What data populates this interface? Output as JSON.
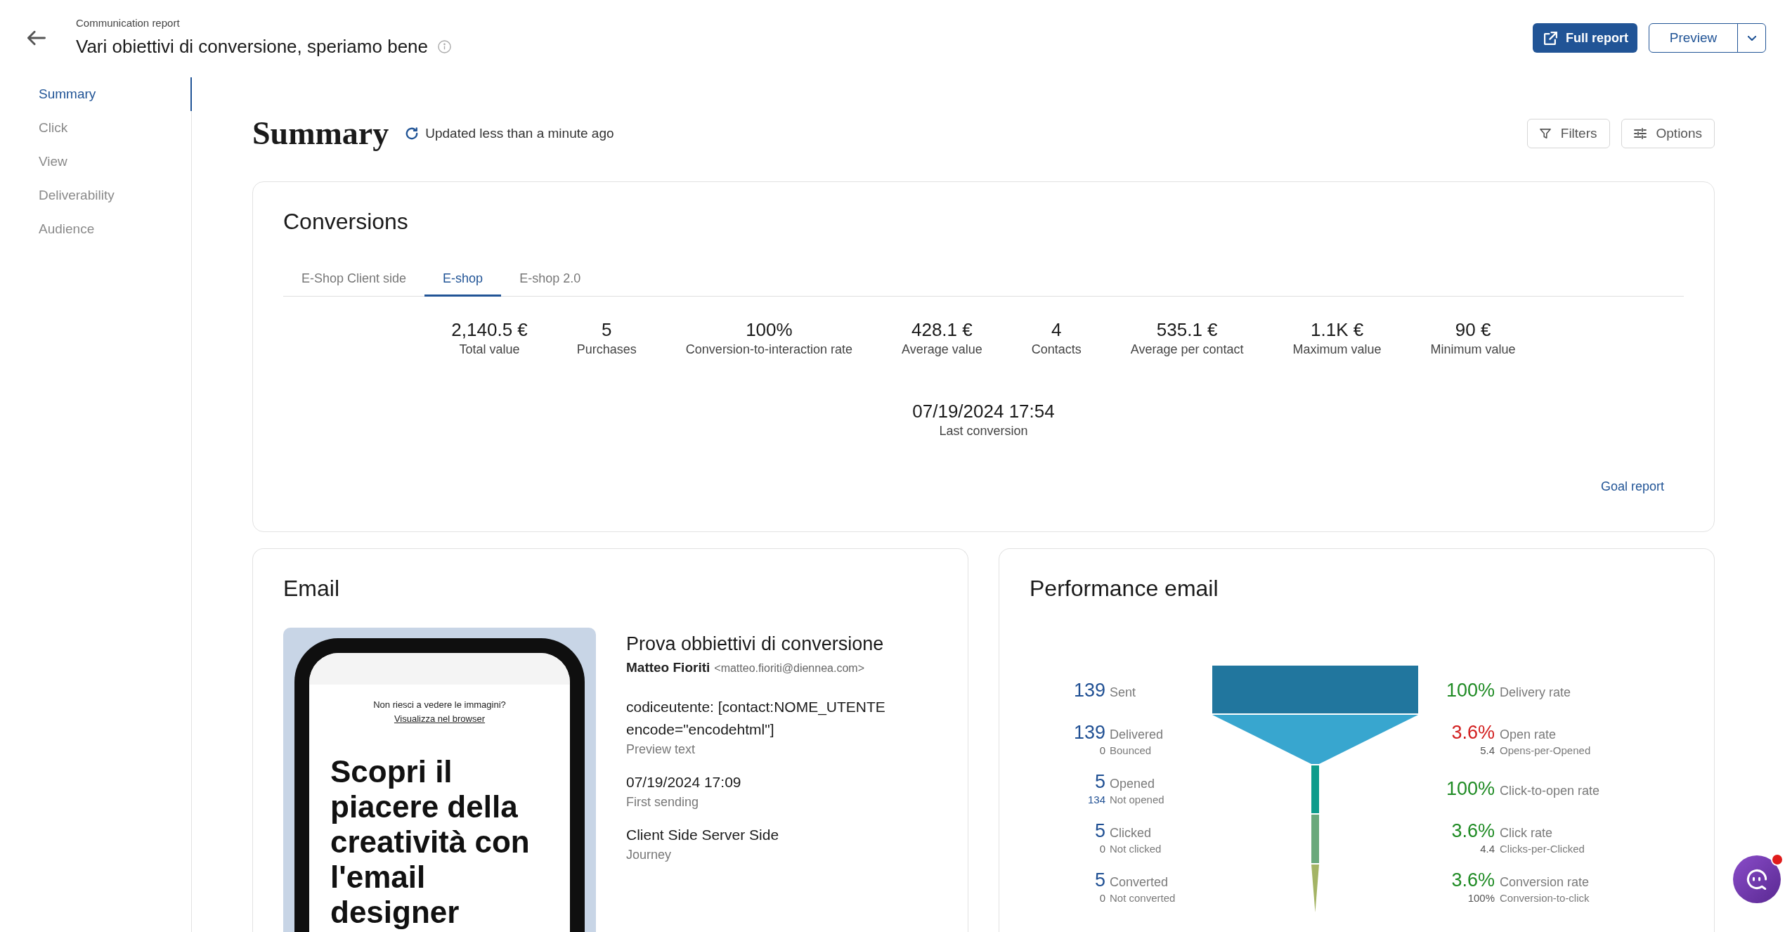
{
  "header": {
    "breadcrumb": "Communication report",
    "title": "Vari obiettivi di conversione, speriamo bene"
  },
  "actions": [
    {
      "kind": "primary",
      "label": "Full report"
    },
    {
      "kind": "split",
      "label": "Preview"
    }
  ],
  "sidebar": {
    "items": [
      {
        "label": "Summary",
        "selected": true
      },
      {
        "label": "Click",
        "selected": false
      },
      {
        "label": "View",
        "selected": false
      },
      {
        "label": "Deliverability",
        "selected": false
      },
      {
        "label": "Audience",
        "selected": false
      }
    ]
  },
  "summary": {
    "title": "Summary",
    "updated": "Updated less than a minute ago",
    "tools": [
      {
        "kind": "filter",
        "label": "Filters"
      },
      {
        "kind": "options",
        "label": "Options"
      }
    ]
  },
  "conversions": {
    "title": "Conversions",
    "tabs": [
      {
        "label": "E-Shop Client side",
        "selected": false
      },
      {
        "label": "E-shop",
        "selected": true
      },
      {
        "label": "E-shop 2.0",
        "selected": false
      }
    ],
    "stats": [
      {
        "value": "2,140.5 €",
        "label": "Total value"
      },
      {
        "value": "5",
        "label": "Purchases"
      },
      {
        "value": "100%",
        "label": "Conversion-to-interaction rate"
      },
      {
        "value": "428.1 €",
        "label": "Average value"
      },
      {
        "value": "4",
        "label": "Contacts"
      },
      {
        "value": "535.1 €",
        "label": "Average per contact"
      },
      {
        "value": "1.1K €",
        "label": "Maximum value"
      },
      {
        "value": "90 €",
        "label": "Minimum value"
      }
    ],
    "last_conversion": {
      "value": "07/19/2024 17:54",
      "label": "Last conversion"
    },
    "link": "Goal report"
  },
  "email": {
    "title": "Email",
    "preview": {
      "notice": "Non riesci a vedere le immagini?",
      "notice_link": "Visualizza nel browser",
      "headline": "Scopri il piacere della creatività con l'email designer"
    },
    "subject": "Prova obbiettivi di conversione",
    "sender_name": "Matteo Fioriti",
    "sender_email": "<matteo.fioriti@diennea.com>",
    "fields": [
      {
        "value": "codiceutente: [contact:NOME_UTENTE encode=\"encodehtml\"]",
        "label": "Preview text"
      },
      {
        "value": "07/19/2024 17:09",
        "label": "First sending"
      },
      {
        "value": "Client Side Server Side",
        "label": "Journey"
      }
    ]
  },
  "performance": {
    "title": "Performance email",
    "counts": [
      {
        "value": "139",
        "label": "Sent"
      },
      {
        "value": "139",
        "label": "Delivered",
        "sub_value": "0",
        "sub_label": "Bounced",
        "sub_highlight": false
      },
      {
        "value": "5",
        "label": "Opened",
        "sub_value": "134",
        "sub_label": "Not opened",
        "sub_highlight": true
      },
      {
        "value": "5",
        "label": "Clicked",
        "sub_value": "0",
        "sub_label": "Not clicked",
        "sub_highlight": false
      },
      {
        "value": "5",
        "label": "Converted",
        "sub_value": "0",
        "sub_label": "Not converted",
        "sub_highlight": false
      }
    ],
    "rates": [
      {
        "value": "100%",
        "label": "Delivery rate",
        "color": "#1f8b24"
      },
      {
        "value": "3.6%",
        "label": "Open rate",
        "color": "#d21f1f",
        "sub_value": "5.4",
        "sub_label": "Opens-per-Opened"
      },
      {
        "value": "100%",
        "label": "Click-to-open rate",
        "color": "#1f8b24"
      },
      {
        "value": "3.6%",
        "label": "Click rate",
        "color": "#1f8b24",
        "sub_value": "4.4",
        "sub_label": "Clicks-per-Clicked"
      },
      {
        "value": "3.6%",
        "label": "Conversion rate",
        "color": "#1f8b24",
        "sub_value": "100%",
        "sub_label": "Conversion-to-click"
      }
    ]
  },
  "chat": {
    "unread": true
  }
}
